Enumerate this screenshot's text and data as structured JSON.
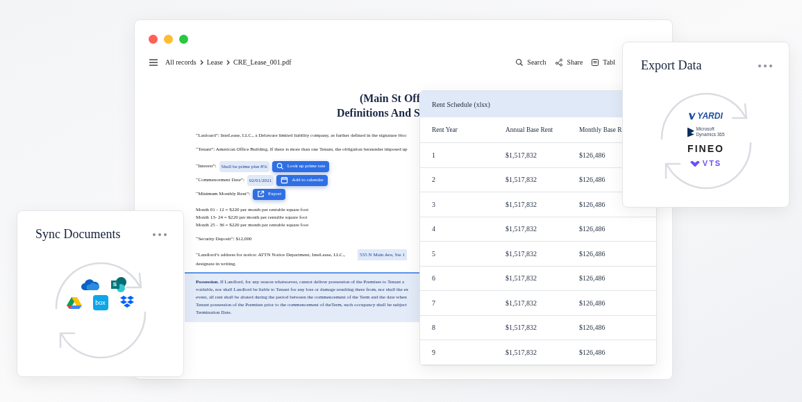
{
  "window_controls": [
    {
      "color": "#fe5f57"
    },
    {
      "color": "#febc2e"
    },
    {
      "color": "#28c840"
    }
  ],
  "breadcrumb": [
    "All records",
    "Lease",
    "CRE_Lease_001.pdf"
  ],
  "toolbar": [
    {
      "kind": "search",
      "label": "Search"
    },
    {
      "kind": "share",
      "label": "Share"
    },
    {
      "kind": "table",
      "label": "Tabl"
    }
  ],
  "document": {
    "title_lines": [
      "(Main St Off",
      "Definitions And S"
    ],
    "clauses": [
      {
        "kind": "text",
        "text": "“Lanloard”: InteLease, LLC., a Delaware limited liability company, as further defined in the signature bloc"
      },
      {
        "kind": "text",
        "text": "“Tenant”: American Office Building. If there is more than one Tenant, the obligation bereunder imposed up"
      },
      {
        "kind": "field",
        "label": "“Interest”:",
        "value": "Shall be prime plus 8%",
        "action": {
          "label": "Look up prime rate"
        }
      },
      {
        "kind": "field",
        "label": "“Commencement Date”:",
        "value": "02/01/2021",
        "action": {
          "label": "Add to calendar"
        }
      },
      {
        "kind": "field",
        "label": "“Minimum Monthly Rent”:",
        "action": {
          "label": "Export"
        }
      },
      {
        "kind": "lines",
        "lines": [
          "Month 01 - 12 = $220 per month per rentable square foot",
          "Month 13- 24 = $220 per month per rentable square foot",
          "Month 25 - 36 = $220 per month per rentable square foot"
        ]
      },
      {
        "kind": "text",
        "text": "“Security Deposit”: $12,000"
      },
      {
        "kind": "address",
        "text": "“Landlord’s address for notice: ATTN Notice Department, InteLease, LLC.,",
        "value": "555 N Main Ave, Ste 1",
        "continuation": "designate in writing."
      }
    ],
    "highlight_paragraph": [
      "**Possession.**   If Landlord, for any reason whatsoever, cannot deliver possession of the Premises to Tenant a",
      "voidable, nor shall Landlord be liable to Tenant for any loss or damage resulting there from, nor shall the ex",
      "event, all rent shall be abated during the period between the commencement of the Term and the date when",
      "Tenant possession of the Premises prior to the commencement of theTerm, such occupancy shall be subject",
      "Termination Date."
    ]
  },
  "rent_schedule": {
    "title": "Rent Schedule (xlsx)",
    "columns": [
      "Rent Year",
      "Annual Base Rent",
      "Monthly Base R"
    ],
    "rows": [
      [
        "1",
        "$1,517,832",
        "$126,486"
      ],
      [
        "2",
        "$1,517,832",
        "$126,486"
      ],
      [
        "3",
        "$1,517,832",
        "$126,486"
      ],
      [
        "4",
        "$1,517,832",
        "$126,486"
      ],
      [
        "5",
        "$1,517,832",
        "$126,486"
      ],
      [
        "6",
        "$1,517,832",
        "$126,486"
      ],
      [
        "7",
        "$1,517,832",
        "$126,486"
      ],
      [
        "8",
        "$1,517,832",
        "$126,486"
      ],
      [
        "9",
        "$1,517,832",
        "$126,486"
      ]
    ]
  },
  "export_card": {
    "title": "Export Data",
    "logos": [
      {
        "kind": "yardi",
        "text": "YARDI"
      },
      {
        "kind": "dynamics",
        "lines": [
          "Microsoft",
          "Dynamics 365"
        ]
      },
      {
        "kind": "fineo",
        "text": "FINEO"
      },
      {
        "kind": "vts",
        "text": "VTS"
      }
    ]
  },
  "sync_card": {
    "title": "Sync Documents",
    "services": [
      {
        "kind": "onedrive"
      },
      {
        "kind": "sharepoint",
        "text": "S"
      },
      {
        "kind": "gdrive"
      },
      {
        "kind": "box",
        "text": "box"
      },
      {
        "kind": "dropbox"
      }
    ]
  }
}
